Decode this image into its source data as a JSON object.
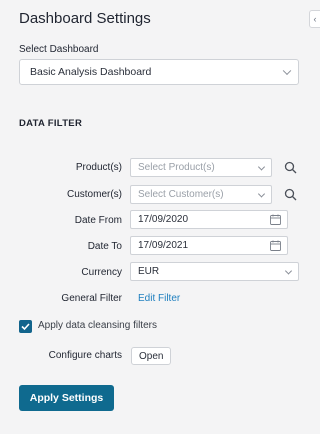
{
  "panel": {
    "title": "Dashboard Settings",
    "collapse_glyph": "‹"
  },
  "dashboard": {
    "label": "Select Dashboard",
    "selected": "Basic Analysis Dashboard"
  },
  "filter": {
    "section_title": "DATA FILTER",
    "products": {
      "label": "Product(s)",
      "placeholder": "Select Product(s)"
    },
    "customers": {
      "label": "Customer(s)",
      "placeholder": "Select Customer(s)"
    },
    "date_from": {
      "label": "Date From",
      "value": "17/09/2020"
    },
    "date_to": {
      "label": "Date To",
      "value": "17/09/2021"
    },
    "currency": {
      "label": "Currency",
      "value": "EUR"
    },
    "general_filter": {
      "label": "General Filter",
      "link": "Edit Filter"
    }
  },
  "cleansing": {
    "checked": true,
    "label": "Apply data cleansing filters"
  },
  "charts": {
    "label": "Configure charts",
    "button": "Open"
  },
  "apply_button": "Apply Settings",
  "colors": {
    "accent": "#0f6a8f",
    "link": "#1e7fbf",
    "background": "#f4f4f5"
  }
}
